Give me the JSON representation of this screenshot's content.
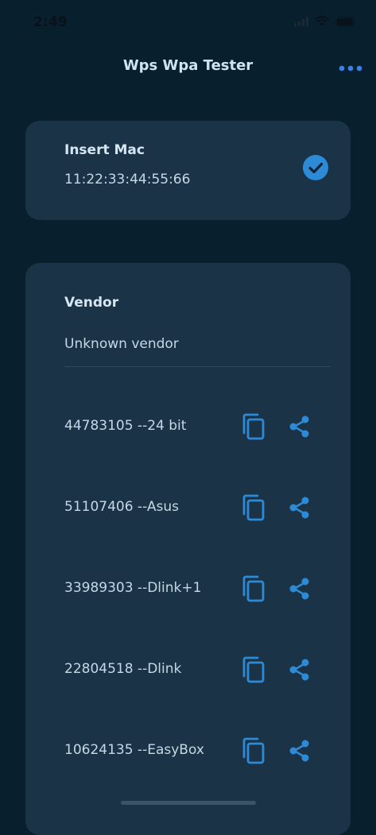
{
  "status_bar": {
    "time": "2:49"
  },
  "header": {
    "title": "Wps Wpa Tester"
  },
  "mac_card": {
    "label": "Insert Mac",
    "value": "11:22:33:44:55:66"
  },
  "results": {
    "vendor_label": "Vendor",
    "vendor_value": "Unknown vendor",
    "pins": [
      {
        "text": "44783105 --24 bit"
      },
      {
        "text": "51107406 --Asus"
      },
      {
        "text": "33989303 --Dlink+1"
      },
      {
        "text": "22804518 --Dlink"
      },
      {
        "text": "10624135 --EasyBox"
      }
    ]
  },
  "colors": {
    "background": "#08202e",
    "card": "#1a3347",
    "accent": "#2d8ad6",
    "more_dots": "#3a7fe8",
    "text": "#c4d8e6"
  },
  "icons": {
    "more": "ellipsis-icon",
    "check": "check-circle-icon",
    "copy": "copy-icon",
    "share": "share-icon"
  }
}
